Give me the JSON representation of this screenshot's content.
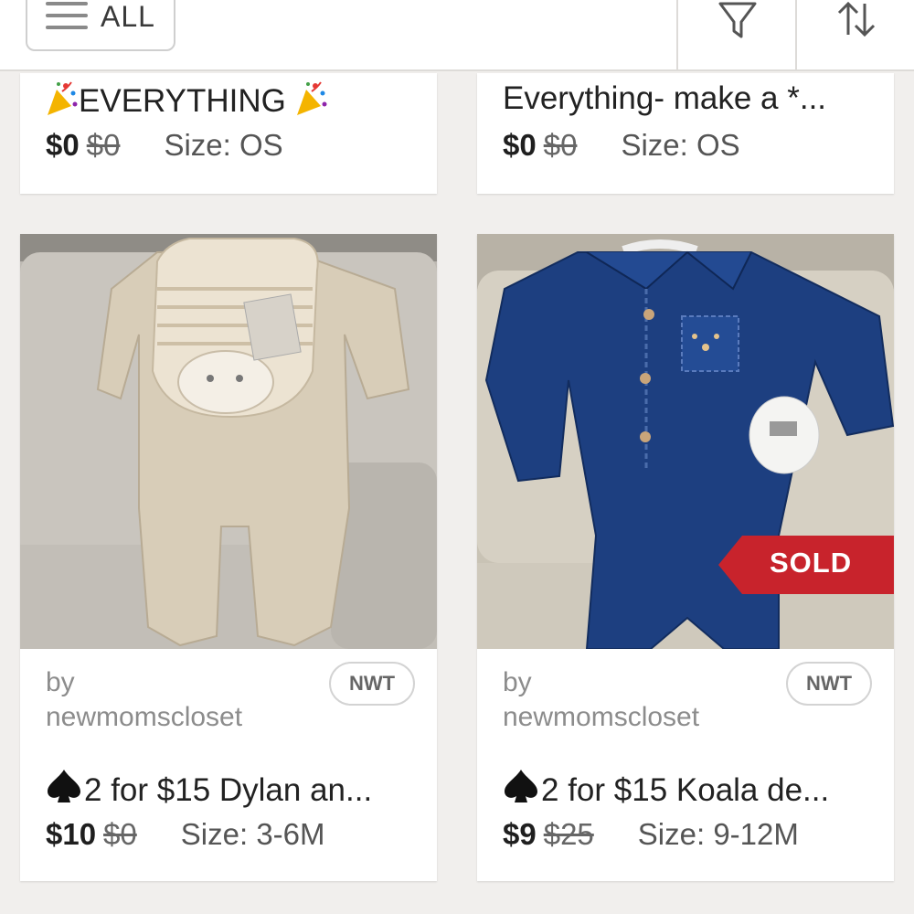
{
  "header": {
    "menu_label": "ALL",
    "filter_icon": "filter-funnel-icon",
    "sort_icon": "sort-arrows-icon"
  },
  "listings_top": [
    {
      "title": "EVERYTHING",
      "price": "$0",
      "original_price": "$0",
      "size": "Size: OS"
    },
    {
      "title": "Everything- make a *...",
      "price": "$0",
      "original_price": "$0",
      "size": "Size: OS"
    }
  ],
  "listings": [
    {
      "by": "by",
      "seller": "newmomscloset",
      "badge": "NWT",
      "title": "2 for $15 Dylan an...",
      "price": "$10",
      "original_price": "$0",
      "size": "Size: 3-6M",
      "sold": false
    },
    {
      "by": "by",
      "seller": "newmomscloset",
      "badge": "NWT",
      "title": "2 for $15 Koala de...",
      "price": "$9",
      "original_price": "$25",
      "size": "Size: 9-12M",
      "sold": true,
      "sold_label": "SOLD"
    }
  ],
  "colors": {
    "sold_banner": "#c8232c",
    "background": "#f1efed"
  }
}
